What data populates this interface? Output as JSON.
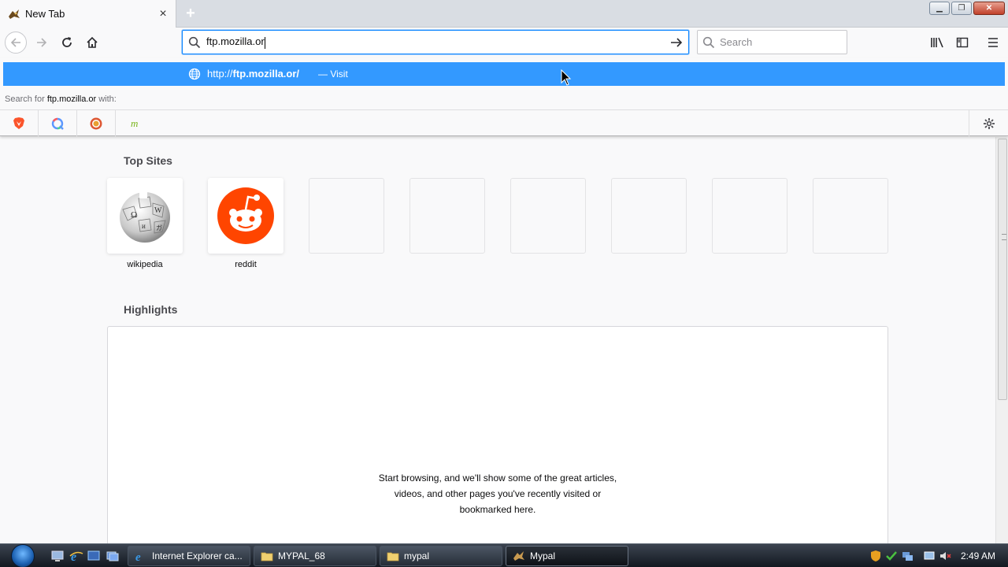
{
  "tab": {
    "title": "New Tab",
    "close": "×"
  },
  "newtab": {
    "label": "+"
  },
  "urlbar": {
    "value": "ftp.mozilla.or"
  },
  "searchbox": {
    "placeholder": "Search"
  },
  "popup": {
    "suggestion_prefix": "http://",
    "suggestion_bold": "ftp.mozilla.or/",
    "suggestion_action": "— Visit",
    "search_for_prefix": "Search for ",
    "search_for_term": "ftp.mozilla.or",
    "search_for_suffix": " with:",
    "engines": [
      "brave-icon",
      "qwant-icon",
      "duckduckgo-icon",
      "mojeek-icon"
    ]
  },
  "topsites": {
    "title": "Top Sites",
    "sites": [
      {
        "label": "wikipedia",
        "icon": "wikipedia-icon"
      },
      {
        "label": "reddit",
        "icon": "reddit-icon"
      }
    ],
    "empty_slots": 6
  },
  "highlights": {
    "title": "Highlights",
    "message_line1": "Start browsing, and we'll show some of the great articles,",
    "message_line2": "videos, and other pages you've recently visited or",
    "message_line3": "bookmarked here."
  },
  "taskbar": {
    "tasks": [
      {
        "label": "Internet Explorer ca...",
        "icon": "ie-icon"
      },
      {
        "label": "MYPAL_68",
        "icon": "folder-icon"
      },
      {
        "label": "mypal",
        "icon": "folder-icon"
      },
      {
        "label": "Mypal",
        "icon": "mypal-icon"
      }
    ],
    "clock": "2:49 AM"
  },
  "colors": {
    "accent": "#0a84ff",
    "suggest_bg": "#3399ff",
    "reddit": "#ff4500"
  }
}
